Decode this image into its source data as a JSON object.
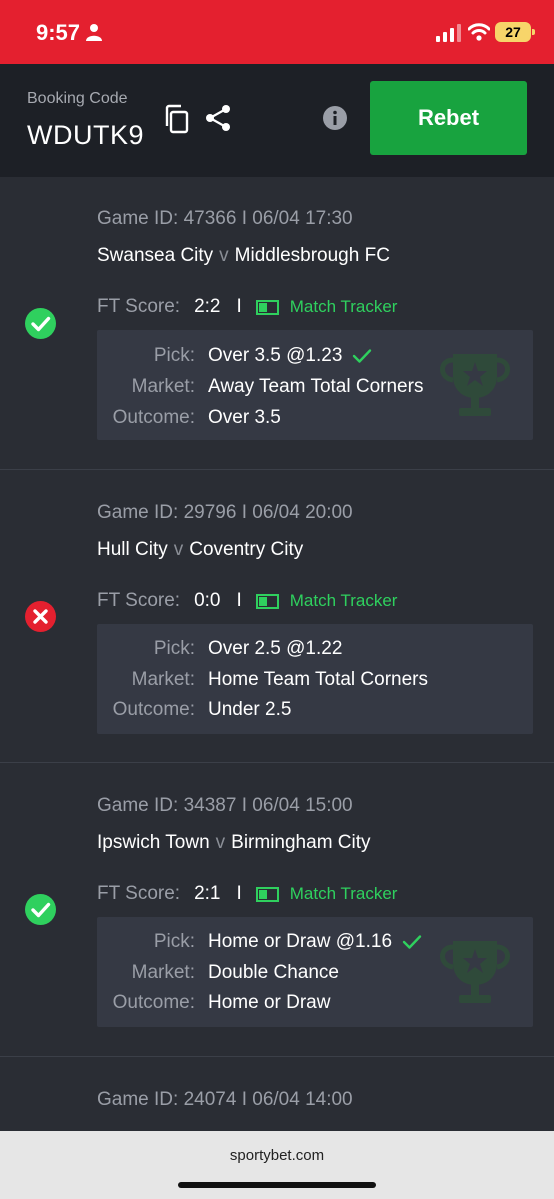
{
  "status_bar": {
    "time": "9:57",
    "battery": "27"
  },
  "header": {
    "booking_label": "Booking Code",
    "booking_code": "WDUTK9",
    "rebet_label": "Rebet",
    "rebet_color": "#18a33f"
  },
  "labels": {
    "ft_score": "FT Score:",
    "match_tracker": "Match Tracker",
    "pick": "Pick:",
    "market": "Market:",
    "outcome": "Outcome:",
    "vs": "v",
    "sep": "I"
  },
  "bets": [
    {
      "game_id": "Game ID: 47366 I 06/04 17:30",
      "home": "Swansea City",
      "away": "Middlesbrough FC",
      "score": "2:2",
      "pick": "Over 3.5 @1.23",
      "market": "Away Team Total Corners",
      "outcome": "Over 3.5",
      "status": "won"
    },
    {
      "game_id": "Game ID: 29796 I 06/04 20:00",
      "home": "Hull City",
      "away": "Coventry City",
      "score": "0:0",
      "pick": "Over 2.5 @1.22",
      "market": "Home Team Total Corners",
      "outcome": "Under 2.5",
      "status": "lost"
    },
    {
      "game_id": "Game ID: 34387 I 06/04 15:00",
      "home": "Ipswich Town",
      "away": "Birmingham City",
      "score": "2:1",
      "pick": "Home or Draw @1.16",
      "market": "Double Chance",
      "outcome": "Home or Draw",
      "status": "won"
    },
    {
      "game_id": "Game ID: 24074 I 06/04 14:00"
    }
  ],
  "browser": {
    "url": "sportybet.com"
  },
  "colors": {
    "won": "#2fd05e",
    "lost": "#e4202f",
    "accent_red": "#e4202f"
  },
  "icons": [
    "person-icon",
    "signal-icon",
    "wifi-icon",
    "copy-icon",
    "share-icon",
    "info-icon",
    "check-circle-icon",
    "cross-circle-icon",
    "match-tracker-icon",
    "checkmark-icon",
    "trophy-icon"
  ]
}
